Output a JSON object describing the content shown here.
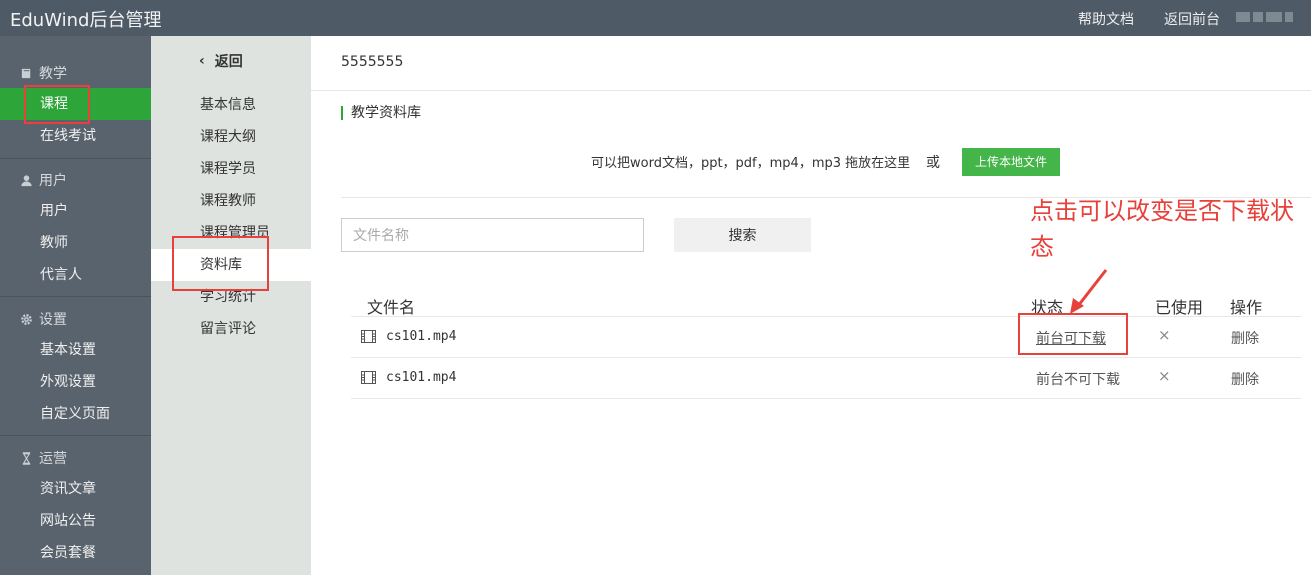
{
  "topbar": {
    "brand": "EduWind后台管理",
    "links": [
      "帮助文档",
      "返回前台"
    ]
  },
  "sidebar": {
    "sections": [
      {
        "title": "教学",
        "icon": "book-icon",
        "items": [
          "课程",
          "在线考试"
        ]
      },
      {
        "title": "用户",
        "icon": "user-icon",
        "items": [
          "用户",
          "教师",
          "代言人"
        ]
      },
      {
        "title": "设置",
        "icon": "gear-icon",
        "items": [
          "基本设置",
          "外观设置",
          "自定义页面"
        ]
      },
      {
        "title": "运营",
        "icon": "hourglass-icon",
        "items": [
          "资讯文章",
          "网站公告",
          "会员套餐"
        ]
      }
    ],
    "active_item": "课程"
  },
  "subnav": {
    "back_label": "返回",
    "items": [
      "基本信息",
      "课程大纲",
      "课程学员",
      "课程教师",
      "课程管理员",
      "资料库",
      "学习统计",
      "留言评论"
    ],
    "active_item": "资料库"
  },
  "main": {
    "course_title": "5555555",
    "section_title": "教学资料库",
    "drop_hint": "可以把word文档，ppt，pdf，mp4，mp3 拖放在这里",
    "or_text": "或",
    "upload_label": "上传本地文件",
    "search_placeholder": "文件名称",
    "search_label": "搜索",
    "table": {
      "headers": [
        "文件名",
        "状态",
        "已使用",
        "操作"
      ],
      "rows": [
        {
          "name": "cs101.mp4",
          "status": "前台可下载",
          "used": "×",
          "action": "删除"
        },
        {
          "name": "cs101.mp4",
          "status": "前台不可下载",
          "used": "×",
          "action": "删除"
        }
      ]
    }
  },
  "annotation": {
    "text": "点击可以改变是否下载状态",
    "color": "#e8403a"
  },
  "colors": {
    "topbar": "#4e5a66",
    "sidebar": "#59636d",
    "accent_green": "#2ea538",
    "subnav": "#dfe3df"
  }
}
